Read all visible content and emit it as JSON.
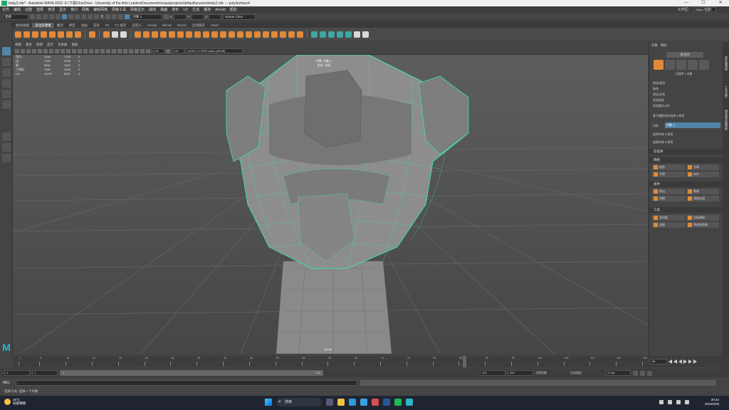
{
  "window": {
    "title": "body2.mb* - Autodesk MAYA 2022: E:\\下载\\OneDrive - University of the Arts London\\Documents\\maya\\projects\\default\\scenes\\body2.mb  ---  polySurface4",
    "minimize": "—",
    "maximize": "☐",
    "close": "✕"
  },
  "menu": {
    "items": [
      "文件",
      "编辑",
      "创建",
      "选择",
      "修改",
      "显示",
      "窗口",
      "网格",
      "编辑网格",
      "网格工具",
      "网格显示",
      "曲线",
      "曲面",
      "变形",
      "UV",
      "生成",
      "缓存",
      "Arnold",
      "帮助"
    ],
    "workspace_label": "工作区:",
    "workspace_value": "Maya 经典*"
  },
  "status": {
    "mode": "建模",
    "symmetry": "无",
    "obj_field": "对象 1",
    "x_label": "X",
    "y_label": "Y",
    "z_label": "Z",
    "user": "Eanae Chen"
  },
  "shelf_tabs": [
    "曲线/曲面",
    "多边形建模",
    "雕刻",
    "绑定",
    "动画",
    "渲染",
    "FX",
    "FX 缓存",
    "自定义",
    "Arnold",
    "Bifrost",
    "MASH",
    "运动图形",
    "XGen"
  ],
  "panel_menu": [
    "视图",
    "着色",
    "照明",
    "显示",
    "渲染器",
    "面板"
  ],
  "panel_tools": {
    "exposure": "0.00",
    "gamma": "1.00",
    "colorspace": "ACES 1.0 SDR-video (sRGB)"
  },
  "hud": [
    [
      "顶点:",
      "4144",
      "1729",
      "0"
    ],
    [
      "边:",
      "7332",
      "3148",
      "0"
    ],
    [
      "面:",
      "3641",
      "1603",
      "0"
    ],
    [
      "三角形:",
      "7060",
      "3206",
      "0"
    ],
    [
      "UV:",
      "13447",
      "6001",
      "0"
    ]
  ],
  "viewport": {
    "object_line1": "对称: 对象 X",
    "object_line2": "拓扑: 关闭",
    "camera": "persp"
  },
  "right_panel": {
    "tabs": [
      "对象",
      "精彩"
    ],
    "header": "多边形",
    "selected_info": "已选择 1 对象",
    "opt1": "按组/相机",
    "opt2": "拖曳",
    "opt3": "滑动/仅拓",
    "opt4": "亮显选框",
    "opt5": "亮显最近元件",
    "soft_label": "基于摄影机的选择 ▾  禁用",
    "symmetry_label": "对称",
    "symmetry_value": "对象 X",
    "sel_lock": "选择约束 ▾  禁用",
    "trans": "变换约束 ▾  禁用",
    "soft_select": "软选择",
    "mesh_section": "网格",
    "mesh_btns": [
      "结合",
      "分离",
      "平滑",
      "布尔"
    ],
    "components_section": "组件",
    "comp_btns": [
      "挤出",
      "倒角",
      "桥接",
      "添加分段"
    ],
    "tools_section": "工具",
    "tool_btns": [
      "多切割",
      "目标焊接",
      "连接",
      "四边形绘制"
    ]
  },
  "side_tabs": [
    "属性编辑器",
    "工具设置",
    "通道盒/层编辑器"
  ],
  "timeline": {
    "ticks": [
      "1",
      "5",
      "10",
      "15",
      "20",
      "25",
      "30",
      "35",
      "40",
      "45",
      "50",
      "55",
      "60",
      "65",
      "70",
      "75",
      "80",
      "85",
      "90",
      "95",
      "100",
      "105",
      "110",
      "115",
      "120"
    ],
    "current_frame": "86"
  },
  "range": {
    "start": "1",
    "start2": "1",
    "slider_start": "1",
    "slider_end": "120",
    "end": "120",
    "end2": "200",
    "char_set": "无角色集",
    "anim_layer": "无动画层",
    "fps": "24 fps"
  },
  "command": {
    "mel": "MEL"
  },
  "help": "选择工具: 选择一个对象",
  "taskbar": {
    "temp": "15°C",
    "weather": "局部晴朗",
    "search": "搜索",
    "time": "20:42",
    "date": "2023/4/29"
  },
  "colors": {
    "accent": "#5285a6",
    "shelf_orange": "#e08a3a",
    "wire": "#3ee0b0"
  }
}
